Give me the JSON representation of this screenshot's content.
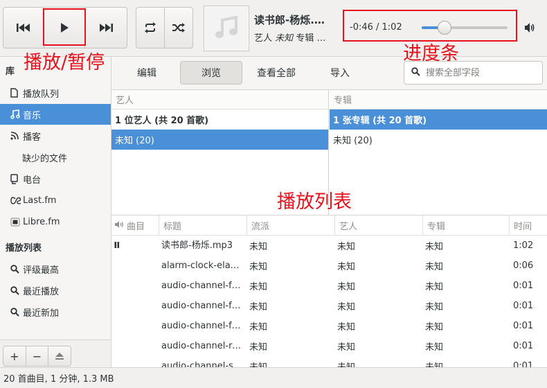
{
  "now_playing": {
    "title": "读书郎-杨烁.…",
    "artist_label": "艺人",
    "artist_value": "未知",
    "album_label": "专辑",
    "album_suffix": "…",
    "time_text": "-0:46 / 1:02",
    "progress_fraction": 0.27
  },
  "annotations": {
    "play_pause": "播放/暂停",
    "progress": "进度条",
    "playlist": "播放列表"
  },
  "sidebar": {
    "library_heading": "库",
    "items": [
      {
        "label": "播放队列",
        "icon": "document-icon"
      },
      {
        "label": "音乐",
        "icon": "music-note-icon",
        "selected": true
      },
      {
        "label": "播客",
        "icon": "rss-icon"
      },
      {
        "label": "缺少的文件",
        "icon": ""
      },
      {
        "label": "电台",
        "icon": "radio-icon"
      },
      {
        "label": "Last.fm",
        "icon": "lastfm-icon"
      },
      {
        "label": "Libre.fm",
        "icon": "librefm-icon"
      }
    ],
    "playlists_heading": "播放列表",
    "playlists": [
      {
        "label": "评级最高",
        "icon": "search-icon"
      },
      {
        "label": "最近播放",
        "icon": "search-icon"
      },
      {
        "label": "最近新加",
        "icon": "search-icon"
      }
    ],
    "footer": {
      "add": "+",
      "remove": "−"
    }
  },
  "toolbar": {
    "edit": "编辑",
    "browse": "浏览",
    "view_all": "查看全部",
    "import": "导入",
    "search_placeholder": "搜索全部字段"
  },
  "browser": {
    "artist_header": "艺人",
    "artist_rows": [
      "1 位艺人 (共 20 首歌)",
      "未知 (20)"
    ],
    "album_header": "专辑",
    "album_rows": [
      "1 张专辑 (共 20 首歌)",
      "未知 (20)"
    ]
  },
  "tracklist": {
    "columns": [
      "曲目",
      "标题",
      "流派",
      "艺人",
      "专辑",
      "时间"
    ],
    "rows": [
      {
        "playing": true,
        "title": "读书郎-杨烁.mp3",
        "genre": "未知",
        "artist": "未知",
        "album": "未知",
        "time": "1:02"
      },
      {
        "playing": false,
        "title": "alarm-clock-elapsed.oga",
        "genre": "未知",
        "artist": "未知",
        "album": "未知",
        "time": "0:06"
      },
      {
        "playing": false,
        "title": "audio-channel-front-center.oga",
        "genre": "未知",
        "artist": "未知",
        "album": "未知",
        "time": "0:01"
      },
      {
        "playing": false,
        "title": "audio-channel-front-left.oga",
        "genre": "未知",
        "artist": "未知",
        "album": "未知",
        "time": "0:01"
      },
      {
        "playing": false,
        "title": "audio-channel-front-right.oga",
        "genre": "未知",
        "artist": "未知",
        "album": "未知",
        "time": "0:01"
      },
      {
        "playing": false,
        "title": "audio-channel-rear-center.oga",
        "genre": "未知",
        "artist": "未知",
        "album": "未知",
        "time": "0:01"
      },
      {
        "playing": false,
        "title": "audio-channel-side-left.oga",
        "genre": "未知",
        "artist": "未知",
        "album": "未知",
        "time": "0:01"
      }
    ]
  },
  "status": "20 首曲目, 1 分钟, 1.3 MB",
  "colors": {
    "accent": "#4a90d9",
    "annotation": "#e8121c"
  }
}
